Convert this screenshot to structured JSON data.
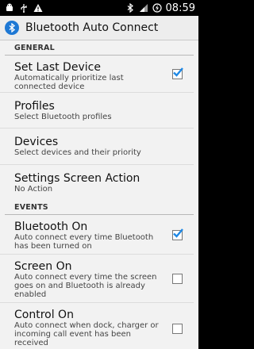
{
  "status_bar": {
    "time": "08:59",
    "icons": [
      "android-debug-icon",
      "usb-icon",
      "warning-icon",
      "bluetooth-icon",
      "signal-icon",
      "battery-charging-icon"
    ]
  },
  "action_bar": {
    "title": "Bluetooth Auto Connect",
    "icon": "bluetooth-app-icon"
  },
  "sections": [
    {
      "header": "GENERAL",
      "items": [
        {
          "title": "Set Last Device",
          "summary": "Automatically prioritize last connected device",
          "checkbox": true,
          "checked": true
        },
        {
          "title": "Profiles",
          "summary": "Select Bluetooth profiles",
          "checkbox": false
        },
        {
          "title": "Devices",
          "summary": "Select devices and their priority",
          "checkbox": false
        },
        {
          "title": "Settings Screen Action",
          "summary": "No Action",
          "checkbox": false
        }
      ]
    },
    {
      "header": "EVENTS",
      "items": [
        {
          "title": "Bluetooth On",
          "summary": "Auto connect every time Bluetooth has been turned on",
          "checkbox": true,
          "checked": true
        },
        {
          "title": "Screen On",
          "summary": "Auto connect every time the screen goes on and Bluetooth is already enabled",
          "checkbox": true,
          "checked": false
        },
        {
          "title": "Control On",
          "summary": "Auto connect when dock, charger or incoming call event has been received",
          "checkbox": true,
          "checked": false
        }
      ]
    }
  ],
  "colors": {
    "accent": "#1e78d4",
    "background": "#f2f2f2",
    "status_bar": "#000000"
  }
}
